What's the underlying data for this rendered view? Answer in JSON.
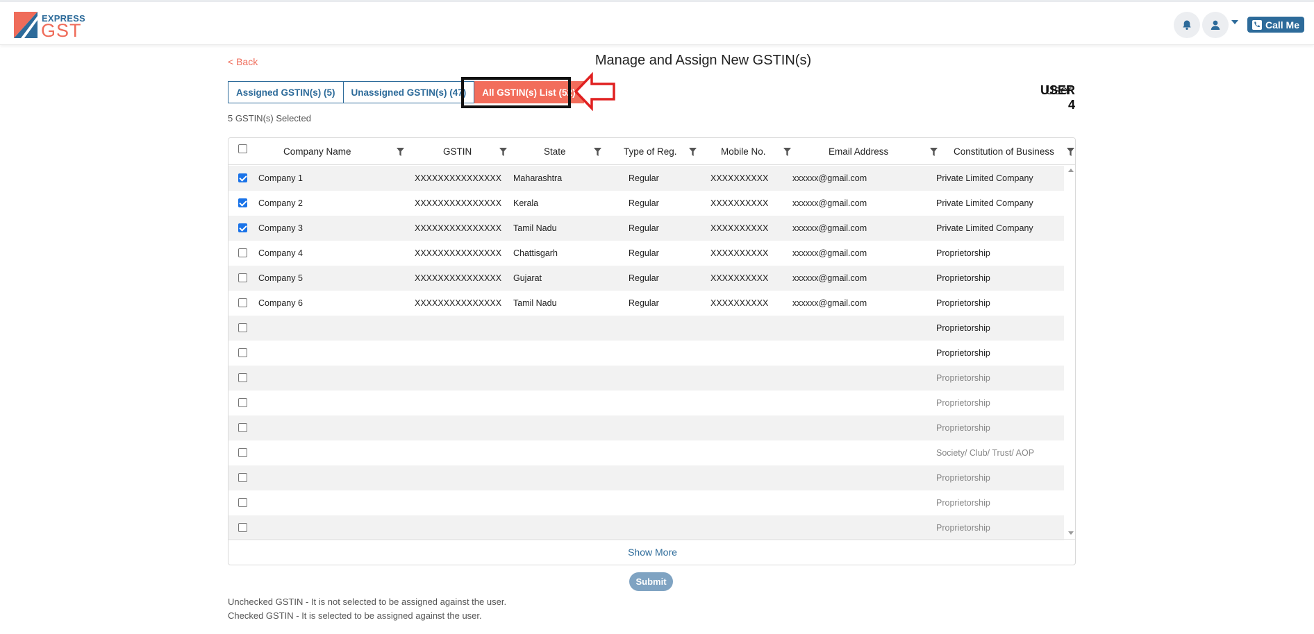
{
  "header": {
    "logo_top": "EXPRESS",
    "logo_bottom": "GST",
    "call_label": "Call Me",
    "icons": [
      "bell-icon",
      "user-icon",
      "chevron-down-icon",
      "phone-icon"
    ]
  },
  "page": {
    "back_label": "< Back",
    "title": "Manage and Assign New GSTIN(s)",
    "user_label": "User:",
    "user_value": "USER 4",
    "selected_count": "5 GSTIN(s) Selected"
  },
  "tabs": [
    {
      "label": "Assigned GSTIN(s) (5)",
      "active": false
    },
    {
      "label": "Unassigned GSTIN(s) (47)",
      "active": false
    },
    {
      "label": "All GSTIN(s) List (52)",
      "active": true
    }
  ],
  "table": {
    "columns": [
      "Company Name",
      "GSTIN",
      "State",
      "Type of Reg.",
      "Mobile No.",
      "Email Address",
      "Constitution of Business"
    ],
    "rows": [
      {
        "checked": true,
        "faded": false,
        "cells": [
          "Company 1",
          "XXXXXXXXXXXXXXX",
          "Maharashtra",
          "Regular",
          "XXXXXXXXXX",
          "xxxxxx@gmail.com",
          "Private Limited Company"
        ]
      },
      {
        "checked": true,
        "faded": false,
        "cells": [
          "Company 2",
          "XXXXXXXXXXXXXXX",
          "Kerala",
          "Regular",
          "XXXXXXXXXX",
          "xxxxxx@gmail.com",
          "Private Limited Company"
        ]
      },
      {
        "checked": true,
        "faded": false,
        "cells": [
          "Company 3",
          "XXXXXXXXXXXXXXX",
          "Tamil Nadu",
          "Regular",
          "XXXXXXXXXX",
          "xxxxxx@gmail.com",
          "Private Limited Company"
        ]
      },
      {
        "checked": false,
        "faded": false,
        "cells": [
          "Company 4",
          "XXXXXXXXXXXXXXX",
          "Chattisgarh",
          "Regular",
          "XXXXXXXXXX",
          "xxxxxx@gmail.com",
          "Proprietorship"
        ]
      },
      {
        "checked": false,
        "faded": false,
        "cells": [
          "Company 5",
          "XXXXXXXXXXXXXXX",
          "Gujarat",
          "Regular",
          "XXXXXXXXXX",
          "xxxxxx@gmail.com",
          "Proprietorship"
        ]
      },
      {
        "checked": false,
        "faded": false,
        "cells": [
          "Company 6",
          "XXXXXXXXXXXXXXX",
          "Tamil Nadu",
          "Regular",
          "XXXXXXXXXX",
          "xxxxxx@gmail.com",
          "Proprietorship"
        ]
      },
      {
        "checked": false,
        "faded": false,
        "cells": [
          "",
          "",
          "",
          "",
          "",
          "",
          "Proprietorship"
        ]
      },
      {
        "checked": false,
        "faded": false,
        "cells": [
          "",
          "",
          "",
          "",
          "",
          "",
          "Proprietorship"
        ]
      },
      {
        "checked": false,
        "faded": true,
        "cells": [
          "",
          "",
          "",
          "",
          "",
          "",
          "Proprietorship"
        ]
      },
      {
        "checked": false,
        "faded": true,
        "cells": [
          "",
          "",
          "",
          "",
          "",
          "",
          "Proprietorship"
        ]
      },
      {
        "checked": false,
        "faded": true,
        "cells": [
          "",
          "",
          "",
          "",
          "",
          "",
          "Proprietorship"
        ]
      },
      {
        "checked": false,
        "faded": true,
        "cells": [
          "",
          "",
          "",
          "",
          "",
          "",
          "Society/ Club/ Trust/ AOP"
        ]
      },
      {
        "checked": false,
        "faded": true,
        "cells": [
          "",
          "",
          "",
          "",
          "",
          "",
          "Proprietorship"
        ]
      },
      {
        "checked": false,
        "faded": true,
        "cells": [
          "",
          "",
          "",
          "",
          "",
          "",
          "Proprietorship"
        ]
      },
      {
        "checked": false,
        "faded": true,
        "cells": [
          "",
          "",
          "",
          "",
          "",
          "",
          "Proprietorship"
        ]
      }
    ],
    "show_more": "Show More"
  },
  "actions": {
    "submit": "Submit"
  },
  "notes": [
    "Unchecked GSTIN - It is not selected to be assigned against the user.",
    "Checked GSTIN - It is selected to be assigned against the user."
  ],
  "colors": {
    "brand_blue": "#2d6b9a",
    "brand_coral": "#f26d5b",
    "annotation_red": "#e02020"
  }
}
